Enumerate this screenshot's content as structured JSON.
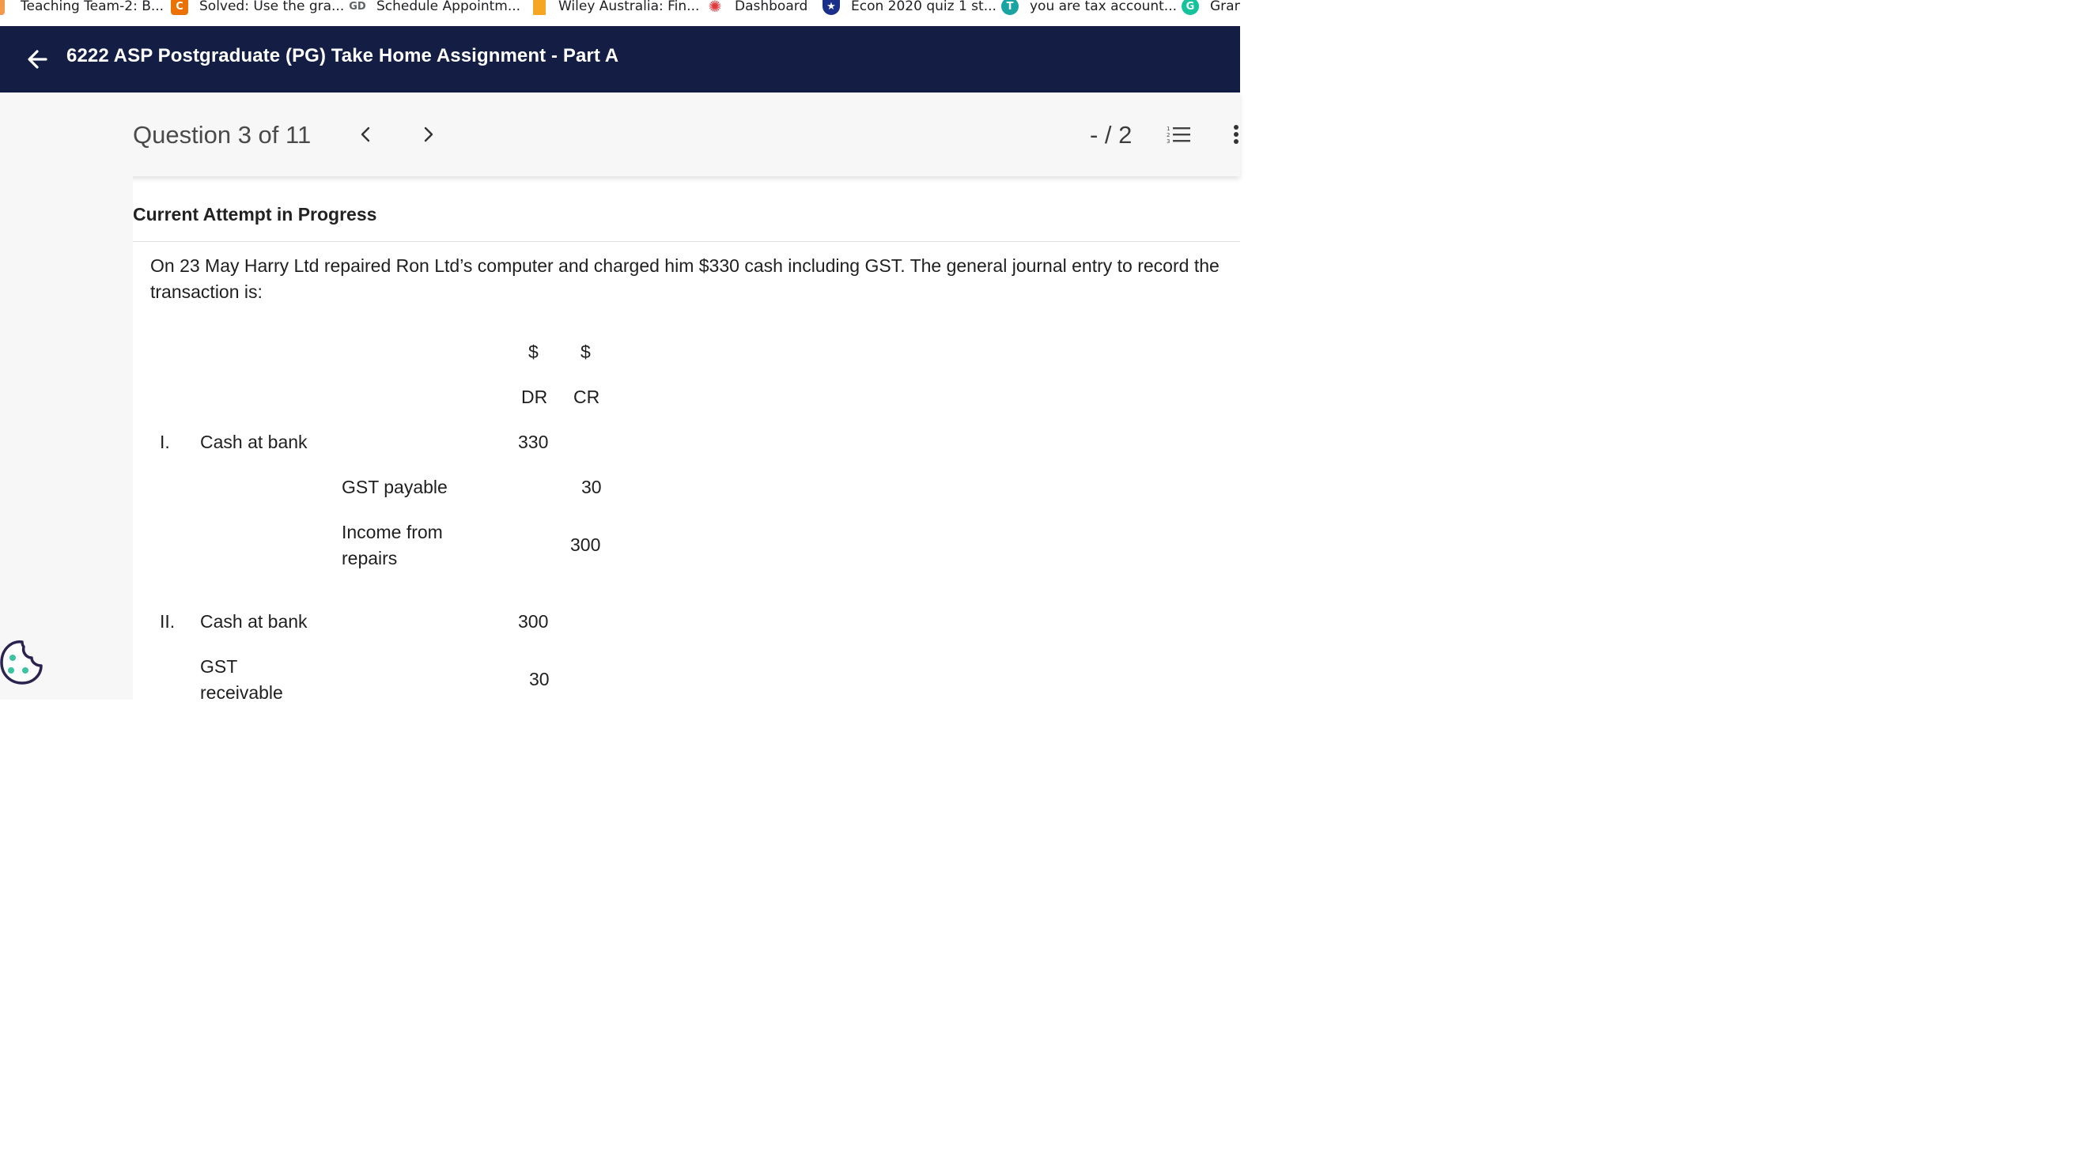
{
  "bookmarks": [
    {
      "label": "Teaching Team-2: B...",
      "icon": "flame-icon",
      "color": "#f2994a"
    },
    {
      "label": "Solved: Use the gra...",
      "icon": "chegg-icon",
      "color": "#eb7100"
    },
    {
      "label": "Schedule Appointm...",
      "icon": "gd-icon",
      "color": "#5f6368"
    },
    {
      "label": "Wiley Australia: Fin...",
      "icon": "wiley-icon",
      "color": "#f5a623"
    },
    {
      "label": "Dashboard",
      "icon": "canvas-icon",
      "color": "#e03a3e"
    },
    {
      "label": "Econ 2020 quiz 1 st...",
      "icon": "star-icon",
      "color": "#1a2f8a"
    },
    {
      "label": "you are tax account...",
      "icon": "shield-icon",
      "color": "#1aa3a3"
    },
    {
      "label": "Gran",
      "icon": "grammarly-icon",
      "color": "#15c39a"
    }
  ],
  "header": {
    "title": "6222 ASP Postgraduate (PG) Take Home Assignment - Part A",
    "background": "#141e44"
  },
  "question_nav": {
    "counter": "Question 3 of 11",
    "score": "- / 2"
  },
  "attempt_status": "Current Attempt in Progress",
  "question_text": "On 23 May Harry Ltd repaired Ron Ltd’s computer and charged him $330 cash including GST. The general journal entry to record the transaction is:",
  "journal": {
    "currency_dr": "$",
    "currency_cr": "$",
    "dr": "DR",
    "cr": "CR",
    "option_1": {
      "numeral": "I.",
      "debit_account": "Cash at bank",
      "debit_amount": "330",
      "credit_1_account": "GST payable",
      "credit_1_amount": "30",
      "credit_2_line1": "Income from",
      "credit_2_line2": "repairs",
      "credit_2_amount": "300"
    },
    "option_2": {
      "numeral": "II.",
      "debit_account": "Cash at bank",
      "debit_amount": "300",
      "debit_2_line1": "GST",
      "debit_2_line2": "receivable",
      "debit_2_amount": "30"
    }
  }
}
